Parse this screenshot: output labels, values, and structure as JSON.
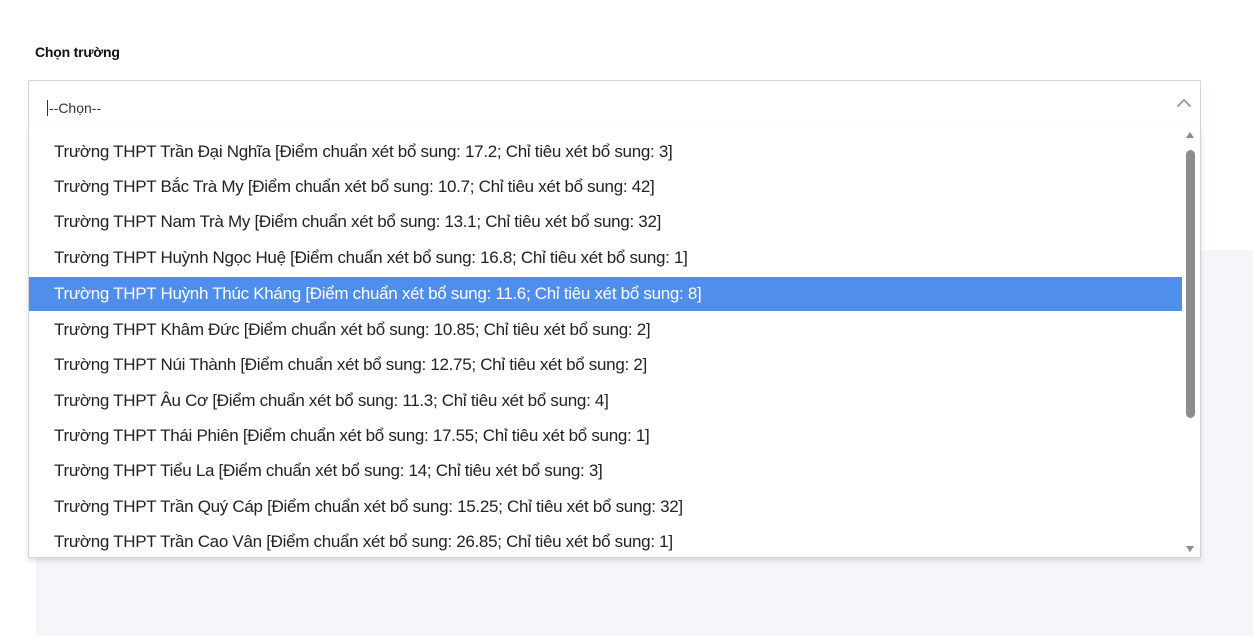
{
  "form": {
    "label": "Chọn trường",
    "selected_value": "--Chọn--"
  },
  "dropdown": {
    "highlighted_index": 4,
    "options": [
      "Trường THPT Trần Đại Nghĩa [Điểm chuẩn xét bổ sung: 17.2; Chỉ tiêu xét bổ sung: 3]",
      "Trường THPT Bắc Trà My [Điểm chuẩn xét bổ sung: 10.7; Chỉ tiêu xét bổ sung: 42]",
      "Trường THPT Nam Trà My [Điểm chuẩn xét bổ sung: 13.1; Chỉ tiêu xét bổ sung: 32]",
      "Trường THPT Huỳnh Ngọc Huệ [Điểm chuẩn xét bổ sung: 16.8; Chỉ tiêu xét bổ sung: 1]",
      "Trường THPT Huỳnh Thúc Kháng [Điểm chuẩn xét bổ sung: 11.6; Chỉ tiêu xét bổ sung: 8]",
      "Trường THPT Khâm Đức [Điểm chuẩn xét bổ sung: 10.85; Chỉ tiêu xét bổ sung: 2]",
      "Trường THPT Núi Thành [Điểm chuẩn xét bổ sung: 12.75; Chỉ tiêu xét bổ sung: 2]",
      "Trường THPT Âu Cơ [Điểm chuẩn xét bổ sung: 11.3; Chỉ tiêu xét bổ sung: 4]",
      "Trường THPT Thái Phiên [Điểm chuẩn xét bổ sung: 17.55; Chỉ tiêu xét bổ sung: 1]",
      "Trường THPT Tiểu La [Điểm chuẩn xét bổ sung: 14; Chỉ tiêu xét bổ sung: 3]",
      "Trường THPT Trần Quý Cáp [Điểm chuẩn xét bổ sung: 15.25; Chỉ tiêu xét bổ sung: 32]",
      "Trường THPT Trần Cao Vân [Điểm chuẩn xét bổ sung: 26.85; Chỉ tiêu xét bổ sung: 1]"
    ]
  },
  "colors": {
    "highlight": "#4f8eec",
    "border": "#cfd4da",
    "background_panel": "#f4f6f9"
  }
}
